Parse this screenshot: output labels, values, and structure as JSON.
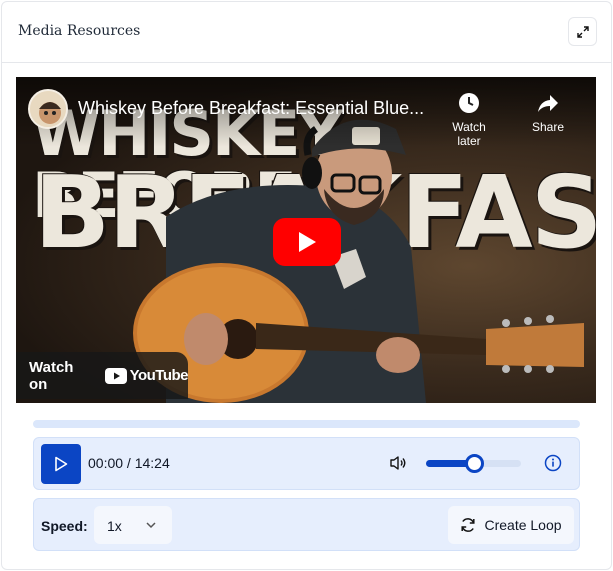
{
  "panel": {
    "title": "Media Resources"
  },
  "video": {
    "title": "Whiskey Before Breakfast: Essential Blue...",
    "thumbnail_text_line1": "WHISKEY BEFORE",
    "thumbnail_text_line2": "BREAKFAST",
    "watch_later_label": "Watch later",
    "share_label": "Share",
    "watch_on_label": "Watch on",
    "youtube_label": "YouTube",
    "colors": {
      "play_overlay": "#ff0000"
    }
  },
  "player": {
    "time": "00:00 / 14:24",
    "progress_fraction": 0,
    "volume_fraction": 0.5
  },
  "speed": {
    "label": "Speed:",
    "value": "1x"
  },
  "loop": {
    "label": "Create Loop"
  },
  "colors": {
    "accent": "#0b45c4",
    "controls_bg": "#e6eefd"
  },
  "icons": [
    "expand-icon",
    "clock-icon",
    "share-icon",
    "play-icon",
    "youtube-logo-icon",
    "speaker-icon",
    "info-icon",
    "chevron-down-icon",
    "refresh-icon"
  ]
}
